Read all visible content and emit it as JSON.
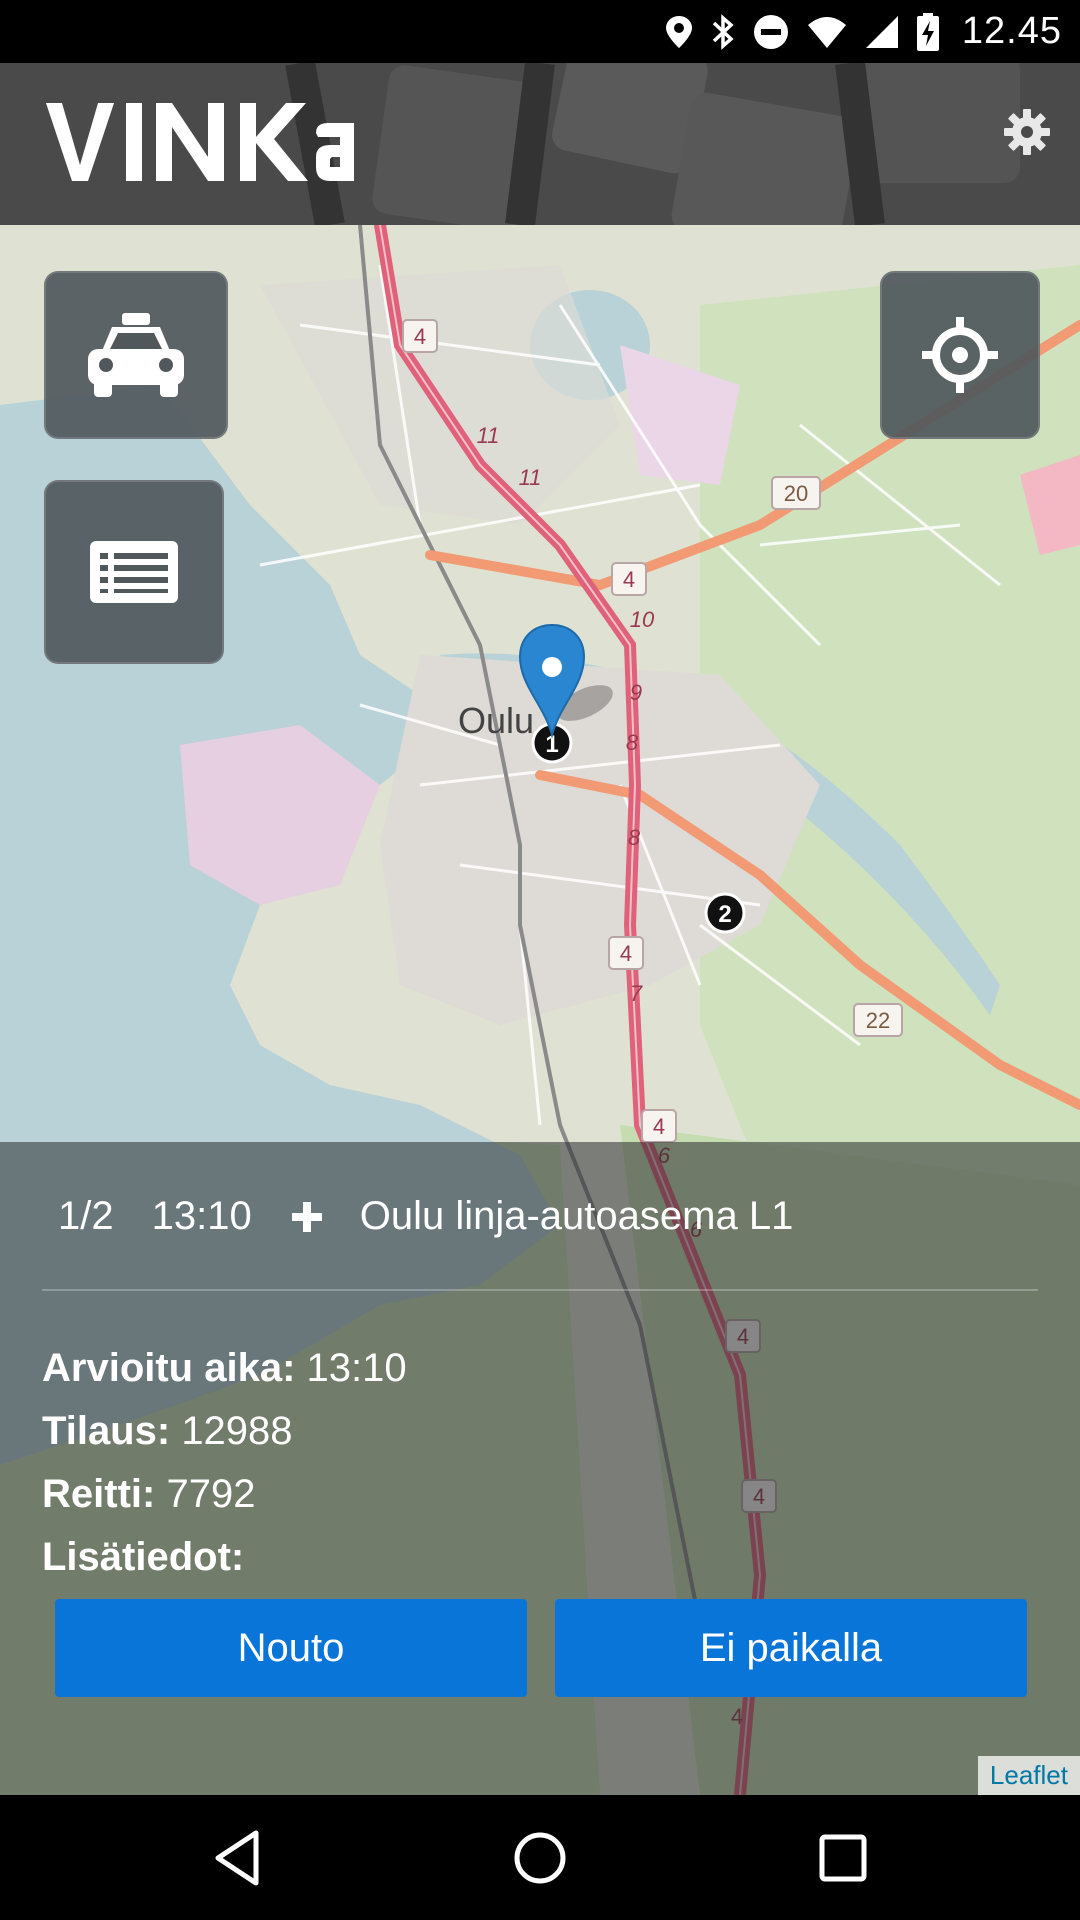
{
  "status_bar": {
    "time": "12.45",
    "icons": [
      "location-icon",
      "bluetooth-icon",
      "do-not-disturb-icon",
      "wifi-icon",
      "signal-icon",
      "battery-charging-icon"
    ]
  },
  "header": {
    "logo_text": "VINKa",
    "settings_icon": "gear-icon"
  },
  "map": {
    "city_label": "Oulu",
    "road_labels": [
      "4",
      "4",
      "4",
      "4",
      "4",
      "4",
      "4",
      "11",
      "11",
      "10",
      "9",
      "8",
      "8",
      "7",
      "6",
      "6",
      "20",
      "22"
    ],
    "markers": [
      {
        "label": "1"
      },
      {
        "label": "2"
      }
    ],
    "fabs": {
      "taxi": "taxi-icon",
      "list": "list-icon",
      "locate": "crosshair-icon"
    },
    "attribution": "Leaflet"
  },
  "stop": {
    "index": "1/2",
    "time": "13:10",
    "icon": "plus-icon",
    "name": "Oulu linja-autoasema L1"
  },
  "details": {
    "estimated_label": "Arvioitu aika:",
    "estimated_value": "13:10",
    "order_label": "Tilaus:",
    "order_value": "12988",
    "route_label": "Reitti:",
    "route_value": "7792",
    "extra_label": "Lisätiedot:",
    "extra_value": ""
  },
  "actions": {
    "pickup": "Nouto",
    "not_present": "Ei paikalla"
  },
  "colors": {
    "button": "#0a75d8",
    "marker": "#2a86d1",
    "highway": "#e0617a",
    "primary_road": "#f19a73"
  }
}
